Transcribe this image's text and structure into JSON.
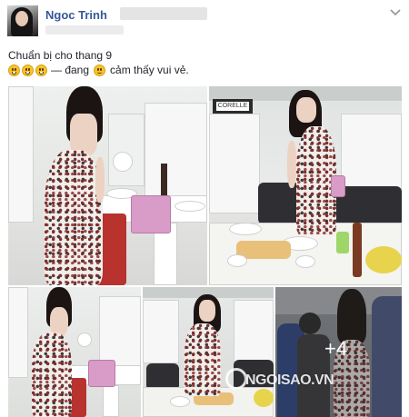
{
  "post": {
    "author": "Ngoc Trinh",
    "caption_line1": "Chuẩn bị cho thang 9",
    "caption_line2_middle": "— đang",
    "caption_line2_end": "cảm thấy vui vẻ."
  },
  "photos": {
    "more_count": "+4"
  },
  "watermark": {
    "text": "NGOISAO.VN"
  },
  "colors": {
    "author_link": "#365899",
    "text": "#1d2129"
  },
  "icons": [
    "chevron-down-icon",
    "emoji-icon"
  ]
}
